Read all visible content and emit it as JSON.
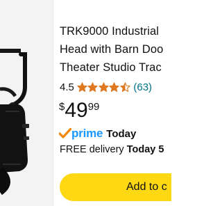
{
  "product": {
    "title_lines": [
      "TRK9000 Industrial",
      "Head with Barn Doo",
      "Theater Studio Trac"
    ],
    "rating": {
      "value": "4.5",
      "stars": 4.5,
      "count": "(63)"
    },
    "price": {
      "symbol": "$",
      "whole": "49",
      "fraction": "99"
    },
    "prime": {
      "word": "prime",
      "label": "Today"
    },
    "delivery": {
      "prefix": "FREE delivery",
      "when": "Today 5"
    },
    "add_button_label": "Add to c",
    "image_icon": "track-light-fixture"
  },
  "colors": {
    "star": "#de7921",
    "link": "#007185",
    "prime_blue": "#1a98ff",
    "prime_check": "#f08804",
    "button": "#ffd814",
    "text": "#0f1111"
  }
}
